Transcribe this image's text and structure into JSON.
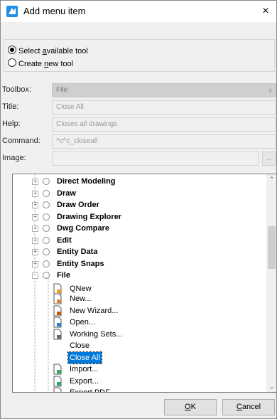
{
  "window": {
    "title": "Add menu item",
    "icon": "app-logo-icon",
    "close_glyph": "×"
  },
  "mode": {
    "select_available_pre": "Select ",
    "select_available_key": "a",
    "select_available_post": "vailable tool",
    "create_new_pre": "Create ",
    "create_new_key": "n",
    "create_new_post": "ew tool",
    "selected": "select_available"
  },
  "fields": {
    "toolbox_label": "Toolbox:",
    "toolbox_value": "File",
    "title_label": "Title:",
    "title_value": "Close All",
    "help_label": "Help:",
    "help_value": "Closes all drawings",
    "command_label": "Command:",
    "command_value": "^c^c_closeall",
    "image_label": "Image:",
    "image_value": "",
    "browse_label": "..."
  },
  "tree": {
    "groups": [
      {
        "label": "Direct Modeling",
        "expanded": false
      },
      {
        "label": "Draw",
        "expanded": false
      },
      {
        "label": "Draw Order",
        "expanded": false
      },
      {
        "label": "Drawing Explorer",
        "expanded": false
      },
      {
        "label": "Dwg Compare",
        "expanded": false
      },
      {
        "label": "Edit",
        "expanded": false
      },
      {
        "label": "Entity Data",
        "expanded": false
      },
      {
        "label": "Entity Snaps",
        "expanded": false
      },
      {
        "label": "File",
        "expanded": true
      }
    ],
    "file_items": [
      {
        "label": "QNew",
        "icon": "qnew-icon",
        "selected": false
      },
      {
        "label": "New...",
        "icon": "new-file-icon",
        "selected": false
      },
      {
        "label": "New Wizard...",
        "icon": "new-wizard-icon",
        "selected": false
      },
      {
        "label": "Open...",
        "icon": "open-file-icon",
        "selected": false
      },
      {
        "label": "Working Sets...",
        "icon": "working-sets-icon",
        "selected": false
      },
      {
        "label": "Close",
        "icon": "",
        "selected": false
      },
      {
        "label": "Close All",
        "icon": "",
        "selected": true
      },
      {
        "label": "Import...",
        "icon": "import-icon",
        "selected": false
      },
      {
        "label": "Export...",
        "icon": "export-icon",
        "selected": false
      },
      {
        "label": "Export PDF...",
        "icon": "export-pdf-icon",
        "selected": false
      }
    ],
    "expand_glyph": "+",
    "collapse_glyph": "−",
    "scroll_position": 0.3
  },
  "buttons": {
    "ok_pre": "",
    "ok_key": "O",
    "ok_post": "K",
    "cancel_pre": "",
    "cancel_key": "C",
    "cancel_post": "ancel"
  },
  "colors": {
    "selection": "#0078d7",
    "tree_line": "#a0a0a0",
    "disabled_text": "#9a9a9a"
  }
}
